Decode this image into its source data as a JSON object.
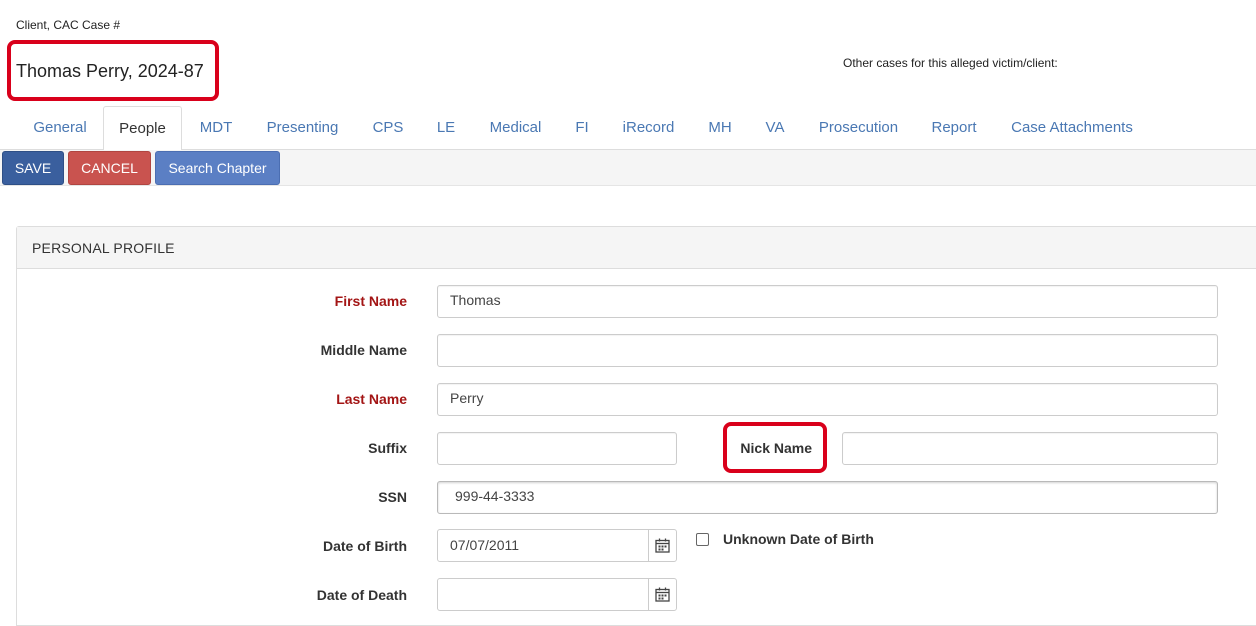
{
  "header": {
    "case_label": "Client, CAC Case #",
    "case_title": "Thomas Perry, 2024-87",
    "other_cases": "Other cases for this alleged victim/client:"
  },
  "tabs": [
    {
      "label": "General"
    },
    {
      "label": "People",
      "active": true
    },
    {
      "label": "MDT"
    },
    {
      "label": "Presenting"
    },
    {
      "label": "CPS"
    },
    {
      "label": "LE"
    },
    {
      "label": "Medical"
    },
    {
      "label": "FI"
    },
    {
      "label": "iRecord"
    },
    {
      "label": "MH"
    },
    {
      "label": "VA"
    },
    {
      "label": "Prosecution"
    },
    {
      "label": "Report"
    },
    {
      "label": "Case Attachments"
    }
  ],
  "toolbar": {
    "save_label": "SAVE",
    "cancel_label": "CANCEL",
    "search_label": "Search Chapter"
  },
  "profile": {
    "heading": "PERSONAL PROFILE",
    "first_name": {
      "label": "First Name",
      "value": "Thomas"
    },
    "middle_name": {
      "label": "Middle Name",
      "value": ""
    },
    "last_name": {
      "label": "Last Name",
      "value": "Perry"
    },
    "suffix": {
      "label": "Suffix",
      "value": ""
    },
    "nick_name": {
      "label": "Nick Name",
      "value": ""
    },
    "ssn": {
      "label": "SSN",
      "value": "999-44-3333"
    },
    "dob": {
      "label": "Date of Birth",
      "value": "07/07/2011"
    },
    "unknown_dob": {
      "label": "Unknown Date of Birth",
      "checked": false
    },
    "dod": {
      "label": "Date of Death",
      "value": ""
    }
  },
  "colors": {
    "required_label": "#a31515",
    "tab_link": "#4a78b3",
    "save": "#3a5f9e",
    "cancel": "#c9534f",
    "search": "#5b7fc4",
    "highlight": "#d9001b"
  }
}
